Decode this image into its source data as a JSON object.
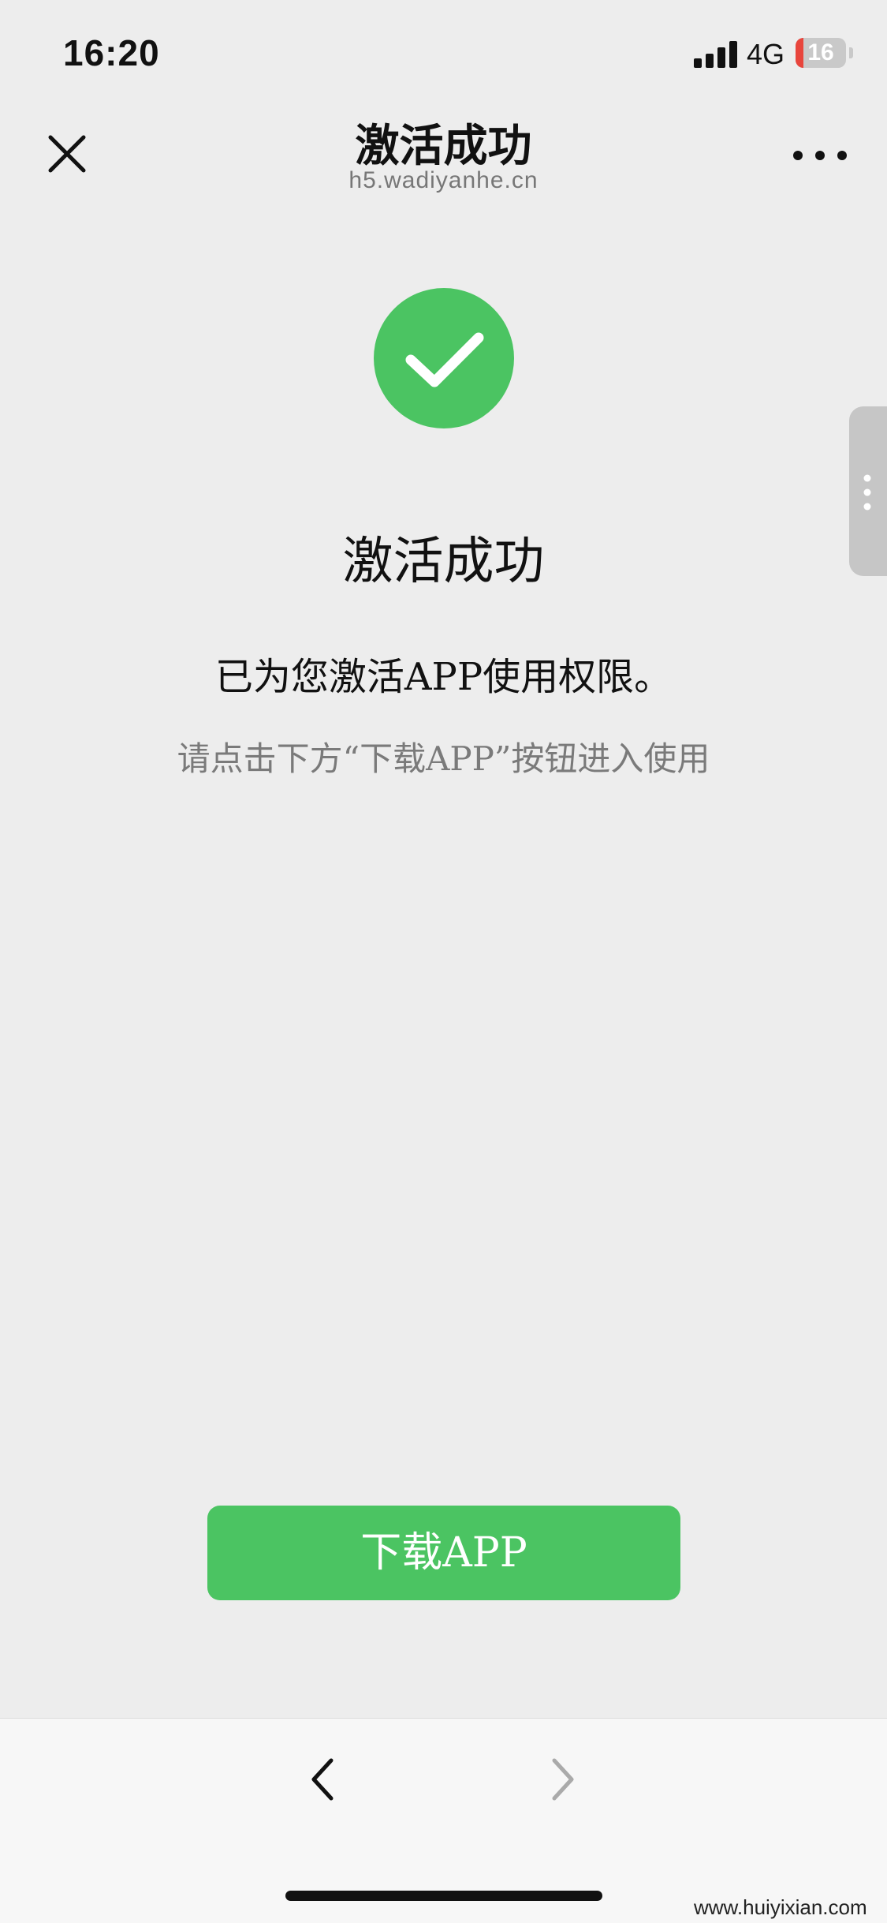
{
  "status_bar": {
    "time": "16:20",
    "network": "4G",
    "battery_level": "16",
    "battery_fraction": 0.16,
    "signal_bars": 4
  },
  "header": {
    "title": "激活成功",
    "subtitle": "h5.wadiyanhe.cn",
    "close_icon": "close-icon",
    "more_icon": "more-icon"
  },
  "content": {
    "icon": "check-circle-icon",
    "heading": "激活成功",
    "description": "已为您激活APP使用权限。",
    "hint": "请点击下方“下载APP”按钮进入使用"
  },
  "download_button": {
    "label": "下载APP"
  },
  "bottom_bar": {
    "back_icon": "back-arrow-icon",
    "forward_icon": "forward-arrow-icon"
  },
  "watermark": "www.huiyixian.com",
  "colors": {
    "accent": "#4bc462",
    "background": "#ededed",
    "battery_low": "#e8453c"
  }
}
